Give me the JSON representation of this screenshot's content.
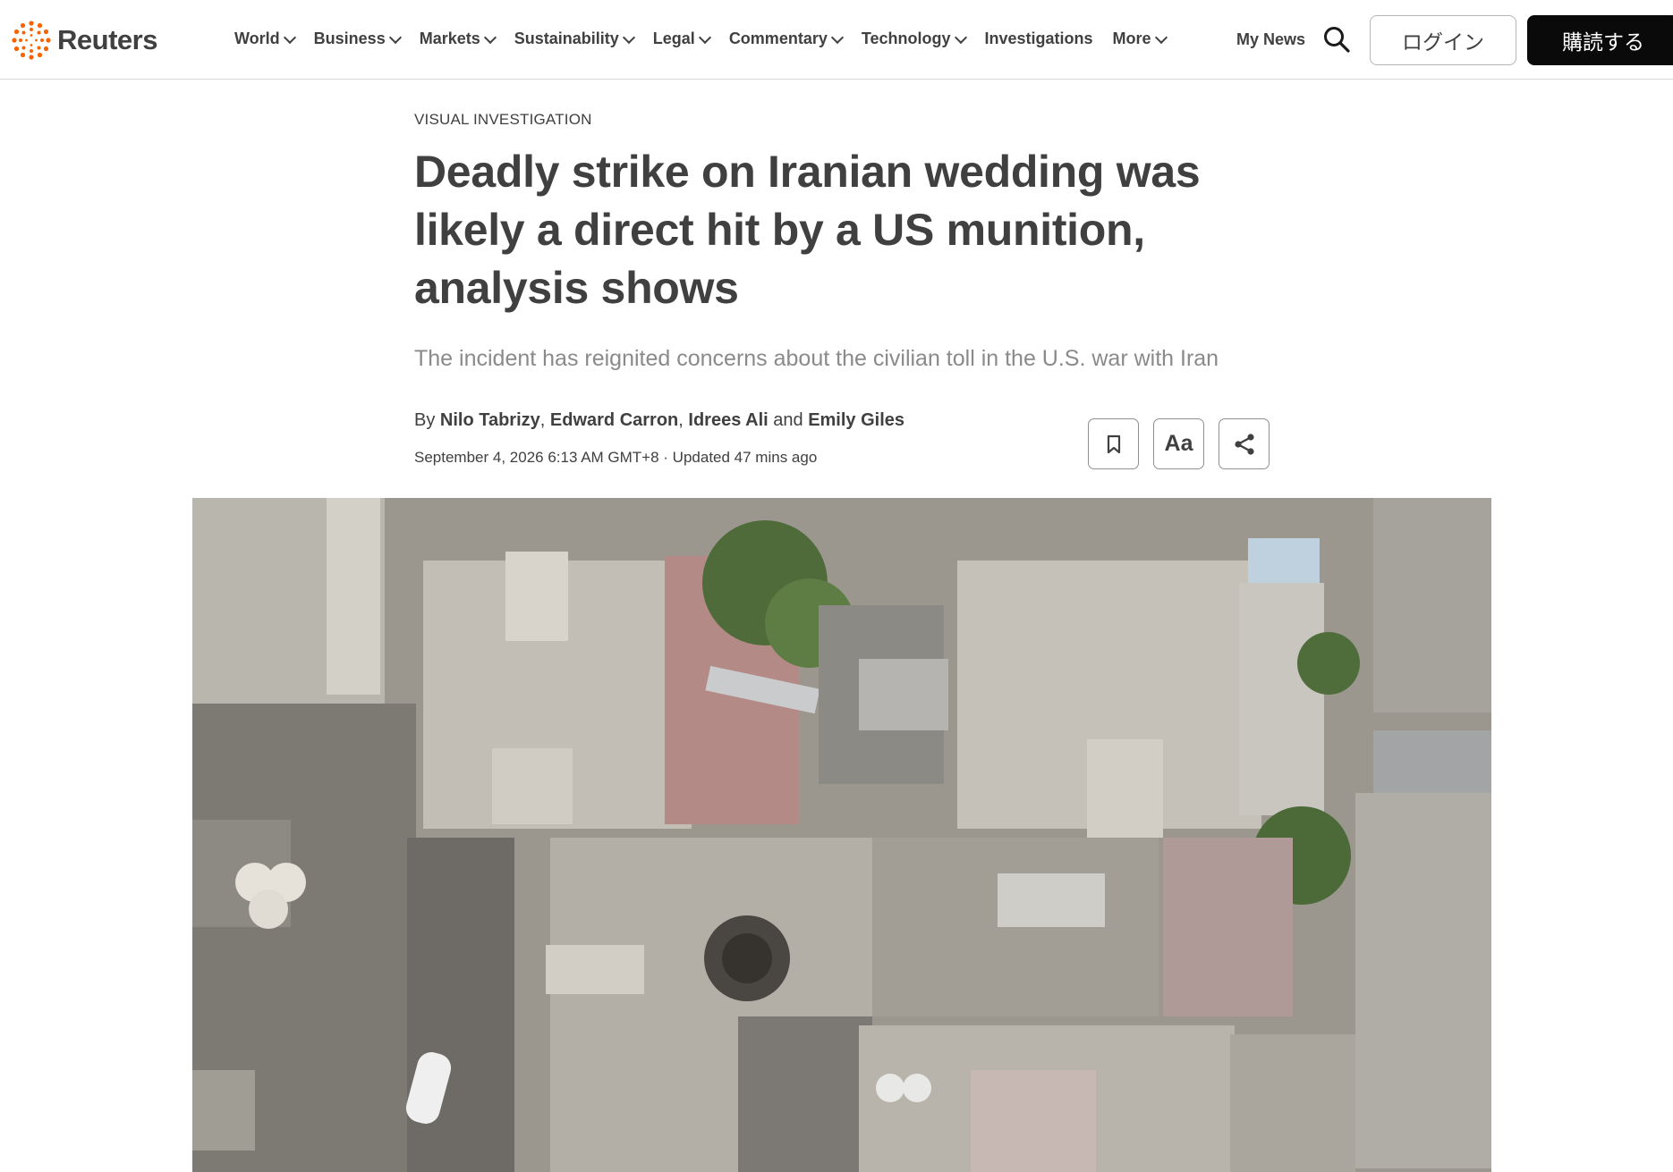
{
  "header": {
    "logo_text": "Reuters",
    "nav": [
      {
        "label": "World",
        "dropdown": true
      },
      {
        "label": "Business",
        "dropdown": true
      },
      {
        "label": "Markets",
        "dropdown": true
      },
      {
        "label": "Sustainability",
        "dropdown": true
      },
      {
        "label": "Legal",
        "dropdown": true
      },
      {
        "label": "Commentary",
        "dropdown": true
      },
      {
        "label": "Technology",
        "dropdown": true
      },
      {
        "label": "Investigations",
        "dropdown": false
      },
      {
        "label": "More",
        "dropdown": true
      }
    ],
    "my_news": "My News",
    "search_icon": "search-icon",
    "login_label": "ログイン",
    "subscribe_label": "購読する",
    "brand_color": "#fa6400"
  },
  "article": {
    "kicker": "VISUAL INVESTIGATION",
    "headline": "Deadly strike on Iranian wedding was likely a direct hit by a US munition, analysis shows",
    "dek": "The incident has reignited concerns about the civilian toll in the U.S. war with Iran",
    "byline": {
      "prefix": "By",
      "authors": [
        "Nilo Tabrizy",
        "Edward Carron",
        "Idrees Ali",
        "Emily Giles"
      ],
      "sep1": ",",
      "sep2": ",",
      "and": "and"
    },
    "dateline": "September 4, 2026 6:13 AM GMT+8 · Updated 47 mins ago",
    "tools": {
      "bookmark_icon": "bookmark-icon",
      "font_label": "Aa",
      "share_icon": "share-icon"
    }
  }
}
